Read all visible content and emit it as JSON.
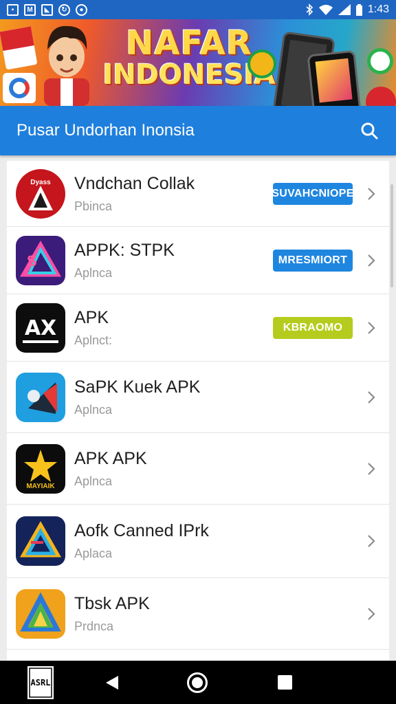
{
  "status_bar": {
    "time": "1:43",
    "left_icons": [
      "image-icon",
      "gmail-icon",
      "notification-icon",
      "sync-icon",
      "record-icon"
    ],
    "right_icons": [
      "bluetooth-icon",
      "wifi-icon",
      "signal-icon",
      "battery-icon"
    ]
  },
  "banner": {
    "line1": "NAFAR",
    "line2": "INDONESIA"
  },
  "header": {
    "title": "Pusar Undorhan Inonsia",
    "search_icon": "search-icon"
  },
  "colors": {
    "header_bg": "#1f7fdc",
    "status_bg": "#1e66c2",
    "blue_button": "#1f86e0",
    "green_button": "#b5cc1e"
  },
  "apps": [
    {
      "name": "Vndchan Collak",
      "subtitle": "Pbinca",
      "button": "SUVAHCNIOPE",
      "button_color": "blue",
      "icon": "red-circle-arrow-icon",
      "icon_text": "Dyass"
    },
    {
      "name": "APPK: STPK",
      "subtitle": "Aplnca",
      "button": "MRESMIORT",
      "button_color": "blue",
      "icon": "purple-triangle-icon",
      "icon_text": "S"
    },
    {
      "name": "APK",
      "subtitle": "Aplnct:",
      "button": "KBRAOMO",
      "button_color": "green",
      "icon": "ax-logo-icon",
      "icon_text": "AX"
    },
    {
      "name": "SaPK Kuek APK",
      "subtitle": "Aplnca",
      "button": "",
      "button_color": "",
      "icon": "blue-megaphone-icon",
      "icon_text": ""
    },
    {
      "name": "APK APK",
      "subtitle": "Aplnca",
      "button": "",
      "button_color": "",
      "icon": "gold-star-icon",
      "icon_text": "MAYIAIK"
    },
    {
      "name": "Aofk Canned IPrk",
      "subtitle": "Aplaca",
      "button": "",
      "button_color": "",
      "icon": "navy-triangle-icon",
      "icon_text": ""
    },
    {
      "name": "Tbsk APK",
      "subtitle": "Prdnca",
      "button": "",
      "button_color": "",
      "icon": "orange-triangle-icon",
      "icon_text": ""
    }
  ],
  "nav_bar": {
    "thumb_text": "ASRL"
  }
}
